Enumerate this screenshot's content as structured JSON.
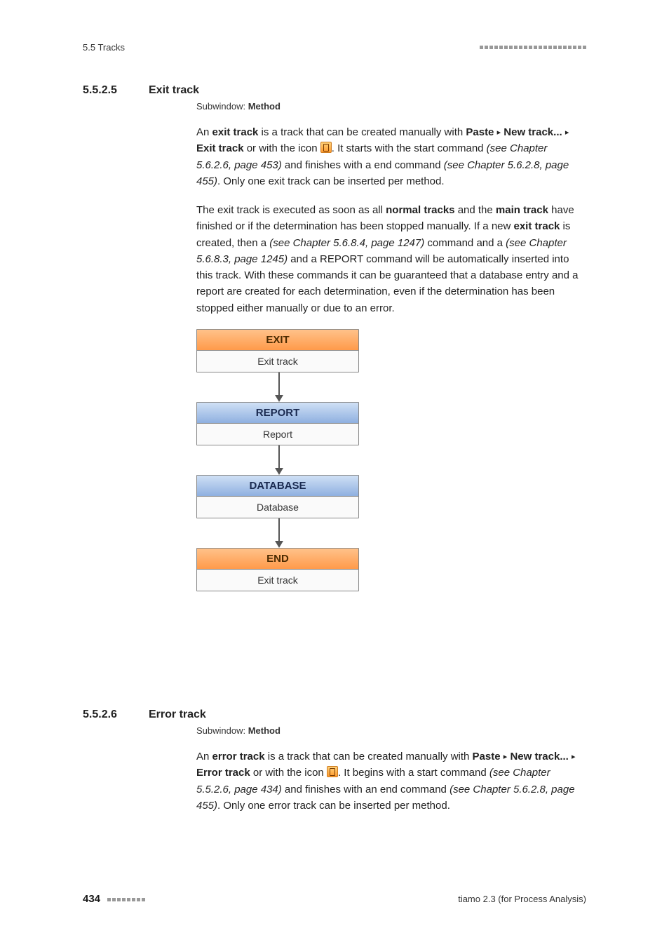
{
  "header": {
    "left": "5.5 Tracks"
  },
  "section1": {
    "num": "5.5.2.5",
    "title": "Exit track",
    "sub_prefix": "Subwindow: ",
    "sub_bold": "Method",
    "p1a": "An ",
    "p1b": "exit track",
    "p1c": " is a track that can be created manually with ",
    "p1d": "Paste",
    "p1e": "New track...",
    "p1f": "Exit track",
    "p1g": " or with the icon ",
    "p1h": ". It starts with the start command ",
    "p1i": "(see Chapter 5.6.2.6, page 453)",
    "p1j": " and finishes with a end command ",
    "p1k": "(see Chapter 5.6.2.8, page 455)",
    "p1l": ". Only one exit track can be inserted per method.",
    "p2a": "The exit track is executed as soon as all ",
    "p2b": "normal tracks",
    "p2c": " and the ",
    "p2d": "main track",
    "p2e": " have finished or if the determination has been stopped manually. If a new ",
    "p2f": "exit track",
    "p2g": " is created, then a ",
    "p2h": "(see Chapter 5.6.8.4, page 1247)",
    "p2i": " command and a ",
    "p2j": "(see Chapter 5.6.8.3, page 1245)",
    "p2k": " and a REPORT command will be automatically inserted into this track. With these commands it can be guaranteed that a database entry and a report are created for each determination, even if the determination has been stopped either manually or due to an error.",
    "diagram": {
      "b1_head": "EXIT",
      "b1_label": "Exit track",
      "b2_head": "REPORT",
      "b2_label": "Report",
      "b3_head": "DATABASE",
      "b3_label": "Database",
      "b4_head": "END",
      "b4_label": "Exit track"
    }
  },
  "section2": {
    "num": "5.5.2.6",
    "title": "Error track",
    "sub_prefix": "Subwindow: ",
    "sub_bold": "Method",
    "p1a": "An ",
    "p1b": "error track",
    "p1c": " is a track that can be created manually with ",
    "p1d": "Paste",
    "p1e": "New track...",
    "p1f": "Error track",
    "p1g": " or with the icon ",
    "p1h": ". It begins with a start command ",
    "p1i": "(see Chapter 5.5.2.6, page 434)",
    "p1j": " and finishes with an end command ",
    "p1k": "(see Chapter 5.6.2.8, page 455)",
    "p1l": ". Only one error track can be inserted per method."
  },
  "footer": {
    "page": "434",
    "right": "tiamo 2.3 (for Process Analysis)"
  },
  "tri": "▸"
}
